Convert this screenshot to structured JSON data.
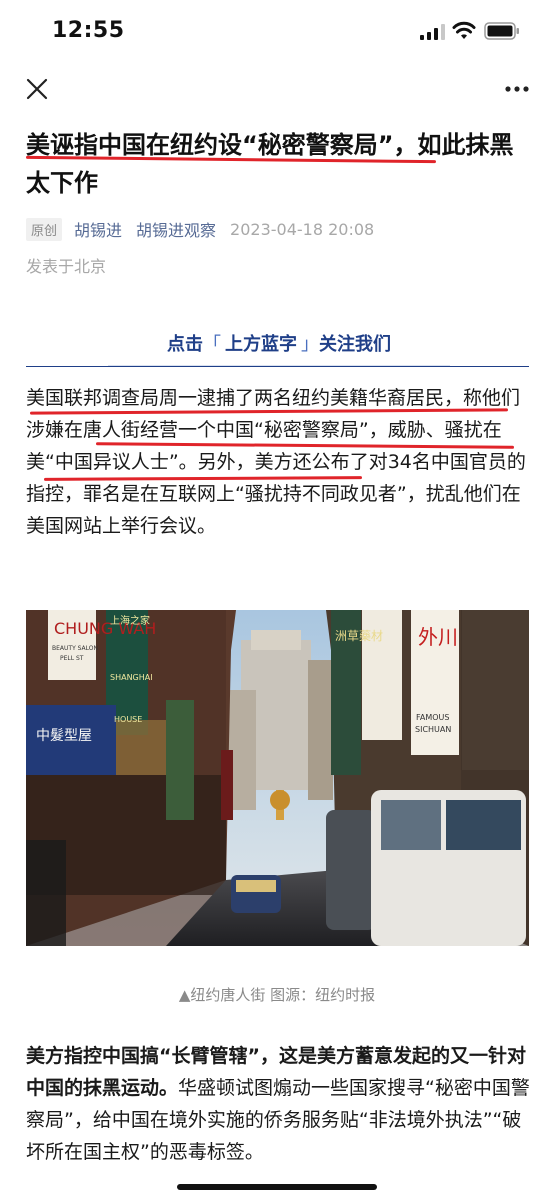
{
  "status_bar": {
    "time": "12:55",
    "signal_icon": "cellular-signal-icon",
    "wifi_icon": "wifi-icon",
    "battery_icon": "battery-icon"
  },
  "nav": {
    "close_icon": "close-icon",
    "more_icon": "more-dots-icon"
  },
  "article": {
    "title": "美诬指中国在纽约设“秘密警察局”，如此抹黑太下作",
    "badge": "原创",
    "author": "胡锡进",
    "account": "胡锡进观察",
    "datetime": "2023-04-18 20:08",
    "location": "发表于北京",
    "follow_banner": {
      "prefix": "点击",
      "highlight": "上方蓝字",
      "suffix": "关注我们"
    },
    "paragraph1": "美国联邦调查局周一逮捕了两名纽约美籍华裔居民，称他们涉嫌在唐人街经营一个中国“秘密警察局”，威胁、骚扰在美“中国异议人士”。另外，美方还公布了对34名中国官员的指控，罪名是在互联网上“骚扰持不同政见者”，扰乱他们在美国网站上举行会议。",
    "image_caption": "▲纽约唐人街 图源：纽约时报",
    "paragraph2_bold": "美方指控中国搞“长臂管辖”，这是美方蓄意发起的又一针对中国的抹黑运动。",
    "paragraph2_rest": "华盛顿试图煽动一些国家搜寻“秘密中国警察局”，给中国在境外实施的侨务服务贴“非法境外执法”“破坏所在国主权”的恶毒标签。"
  },
  "photo": {
    "signs": {
      "chung_wah": "CHUNG WAH",
      "beauty_salon": "BEAUTY SALON",
      "pell_st": "PELL ST",
      "shanghai": "SHANGHAI",
      "house": "HOUSE",
      "shanghai_zh": "上海之家",
      "hair_salon_zh": "中髮型屋",
      "herbs_zh": "洲草藥材",
      "wai_chuan_zh": "外川",
      "famous": "FAMOUS",
      "sichuan": "SICHUAN"
    }
  },
  "colors": {
    "link_blue": "#576b95",
    "banner_blue": "#1f3f88",
    "underline_red": "#e0242a",
    "meta_gray": "#a8a8a8"
  }
}
